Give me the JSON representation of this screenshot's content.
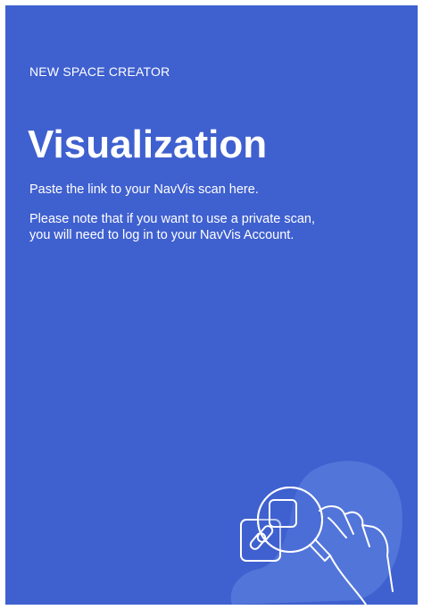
{
  "header": {
    "eyebrow": "NEW SPACE CREATOR",
    "title": "Visualization"
  },
  "body": {
    "intro": "Paste the link to your NavVis scan here.",
    "note_line1": "Please note that if you want to use a private scan,",
    "note_line2": "you will need to log in to your NavVis Account."
  },
  "illustration": {
    "icon": "magnifier-link-hand-icon"
  },
  "colors": {
    "panel_background": "#3f60cf",
    "text": "#ffffff",
    "blob": "#5679dc"
  }
}
